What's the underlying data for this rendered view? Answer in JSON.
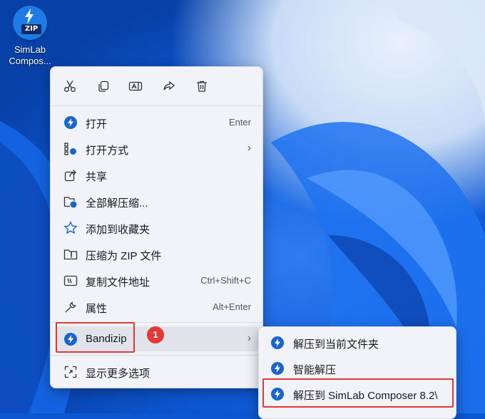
{
  "desktop": {
    "icon_label_line1": "SimLab",
    "icon_label_line2": "Compos...",
    "icon_tag": "ZIP"
  },
  "toolbar": {
    "cut": "cut-icon",
    "copy": "copy-icon",
    "rename": "rename-icon",
    "share": "share-icon",
    "delete": "delete-icon"
  },
  "menu": {
    "open": {
      "label": "打开",
      "shortcut": "Enter"
    },
    "open_with": {
      "label": "打开方式"
    },
    "share": {
      "label": "共享"
    },
    "extract_all": {
      "label": "全部解压缩..."
    },
    "add_favorites": {
      "label": "添加到收藏夹"
    },
    "compress_zip": {
      "label": "压缩为 ZIP 文件"
    },
    "copy_path": {
      "label": "复制文件地址",
      "shortcut": "Ctrl+Shift+C"
    },
    "properties": {
      "label": "属性",
      "shortcut": "Alt+Enter"
    },
    "bandizip": {
      "label": "Bandizip"
    },
    "more_options": {
      "label": "显示更多选项"
    }
  },
  "submenu": {
    "extract_here": "解压到当前文件夹",
    "smart_extract": "智能解压",
    "extract_to": "解压到 SimLab Composer 8.2\\"
  },
  "annotation": {
    "badge": "1"
  },
  "colors": {
    "accent": "#1b64c9",
    "highlight_red": "#e53935"
  }
}
